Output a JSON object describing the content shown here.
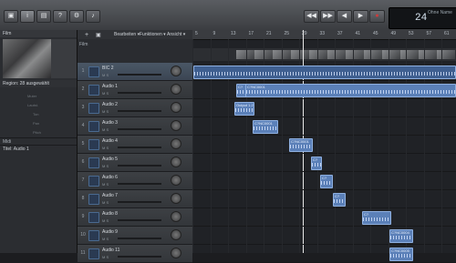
{
  "toolbar": {
    "buttons": [
      "▣",
      "i",
      "▤",
      "?",
      "⚙",
      "♪"
    ],
    "transport": [
      "◀◀",
      "▶▶",
      "◀",
      "▶",
      "●"
    ],
    "lcd": {
      "display": "24",
      "name": "Ohne Name"
    }
  },
  "library": {
    "heading": "Film",
    "region_label": "Region: 28 ausgewählt",
    "params": [
      "Muter",
      "Lautst.",
      "Ton",
      "Pan",
      "Pitch"
    ],
    "midi_label": "Midi",
    "title_label": "Titel: Audio 1"
  },
  "track_menu": [
    "Bearbeiten",
    "Funktionen",
    "Ansicht"
  ],
  "tracks": [
    {
      "num": "1",
      "name": "BIC 2",
      "ms": "M  S"
    },
    {
      "num": "2",
      "name": "Audio 1",
      "ms": "M  S"
    },
    {
      "num": "3",
      "name": "Audio 2",
      "ms": "M  S"
    },
    {
      "num": "4",
      "name": "Audio 3",
      "ms": "M  S"
    },
    {
      "num": "5",
      "name": "Audio 4",
      "ms": "M  S"
    },
    {
      "num": "6",
      "name": "Audio 5",
      "ms": "M  S"
    },
    {
      "num": "7",
      "name": "Audio 6",
      "ms": "M  S"
    },
    {
      "num": "8",
      "name": "Audio 7",
      "ms": "M  S"
    },
    {
      "num": "9",
      "name": "Audio 8",
      "ms": "M  S"
    },
    {
      "num": "10",
      "name": "Audio 9",
      "ms": "M  S"
    },
    {
      "num": "11",
      "name": "Audio 11",
      "ms": "M  S"
    }
  ],
  "ruler_ticks": [
    "5",
    "9",
    "13",
    "17",
    "21",
    "25",
    "29",
    "33",
    "37",
    "41",
    "45",
    "49",
    "53",
    "57",
    "61"
  ],
  "regions": [
    {
      "label": "C?",
      "lane": 2
    },
    {
      "label": "C?NC0001",
      "lane": 2
    },
    {
      "label": "Output 1.2",
      "lane": 3
    },
    {
      "label": "C?NC0001",
      "lane": 4
    },
    {
      "label": "C?NC0001",
      "lane": 5
    },
    {
      "label": "C?",
      "lane": 6
    },
    {
      "label": "C?",
      "lane": 7
    },
    {
      "label": "C?",
      "lane": 8
    },
    {
      "label": "C?",
      "lane": 9
    },
    {
      "label": "C?NC0004",
      "lane": 10
    },
    {
      "label": "C?NC0005",
      "lane": 11
    }
  ],
  "colors": {
    "accent": "#5b80b8",
    "record": "#d23a3a"
  }
}
